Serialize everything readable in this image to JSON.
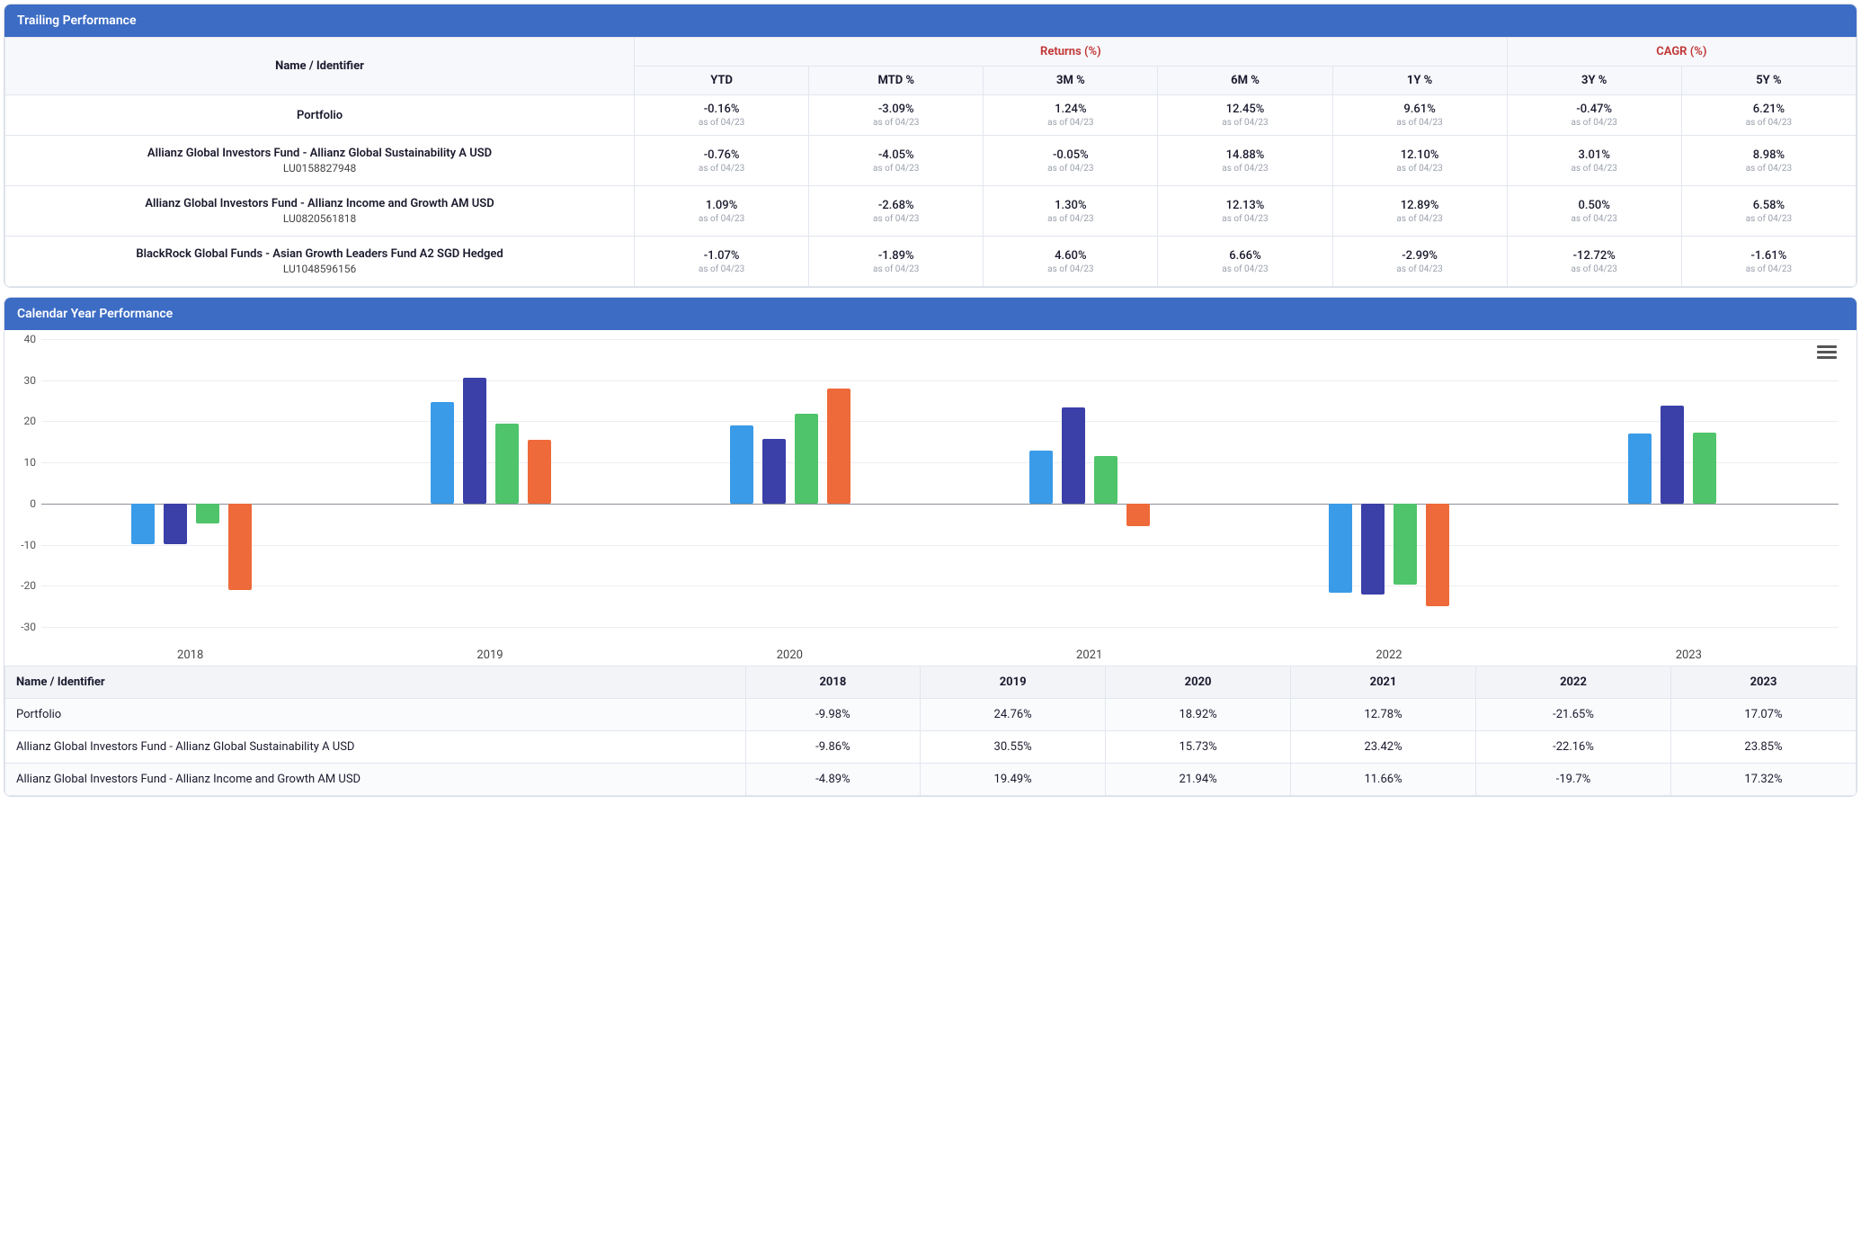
{
  "trailing": {
    "title": "Trailing Performance",
    "col_name": "Name / Identifier",
    "group_returns": "Returns (%)",
    "group_cagr": "CAGR (%)",
    "cols": [
      "YTD",
      "MTD %",
      "3M %",
      "6M %",
      "1Y %",
      "3Y %",
      "5Y %"
    ],
    "asof": "as of 04/23",
    "rows": [
      {
        "name": "Portfolio",
        "sub": "",
        "vals": [
          "-0.16%",
          "-3.09%",
          "1.24%",
          "12.45%",
          "9.61%",
          "-0.47%",
          "6.21%"
        ]
      },
      {
        "name": "Allianz Global Investors Fund - Allianz Global Sustainability A USD",
        "sub": "LU0158827948",
        "vals": [
          "-0.76%",
          "-4.05%",
          "-0.05%",
          "14.88%",
          "12.10%",
          "3.01%",
          "8.98%"
        ]
      },
      {
        "name": "Allianz Global Investors Fund - Allianz Income and Growth AM USD",
        "sub": "LU0820561818",
        "vals": [
          "1.09%",
          "-2.68%",
          "1.30%",
          "12.13%",
          "12.89%",
          "0.50%",
          "6.58%"
        ]
      },
      {
        "name": "BlackRock Global Funds - Asian Growth Leaders Fund A2 SGD Hedged",
        "sub": "LU1048596156",
        "vals": [
          "-1.07%",
          "-1.89%",
          "4.60%",
          "6.66%",
          "-2.99%",
          "-12.72%",
          "-1.61%"
        ]
      }
    ]
  },
  "calendar": {
    "title": "Calendar Year Performance",
    "col_name": "Name / Identifier",
    "years": [
      "2018",
      "2019",
      "2020",
      "2021",
      "2022",
      "2023"
    ],
    "rows": [
      {
        "name": "Portfolio",
        "vals": [
          "-9.98%",
          "24.76%",
          "18.92%",
          "12.78%",
          "-21.65%",
          "17.07%"
        ]
      },
      {
        "name": "Allianz Global Investors Fund - Allianz Global Sustainability A USD",
        "vals": [
          "-9.86%",
          "30.55%",
          "15.73%",
          "23.42%",
          "-22.16%",
          "23.85%"
        ]
      },
      {
        "name": "Allianz Global Investors Fund - Allianz Income and Growth AM USD",
        "vals": [
          "-4.89%",
          "19.49%",
          "21.94%",
          "11.66%",
          "-19.7%",
          "17.32%"
        ]
      }
    ]
  },
  "chart_data": {
    "type": "bar",
    "title": "",
    "xlabel": "",
    "ylabel": "",
    "ylim": [
      -30,
      40
    ],
    "yticks": [
      -30,
      -20,
      -10,
      0,
      10,
      20,
      30,
      40
    ],
    "categories": [
      "2018",
      "2019",
      "2020",
      "2021",
      "2022",
      "2023"
    ],
    "series": [
      {
        "name": "Portfolio",
        "color": "#3a9be8",
        "values": [
          -9.98,
          24.76,
          18.92,
          12.78,
          -21.65,
          17.07
        ]
      },
      {
        "name": "Allianz Global Sustainability A USD",
        "color": "#3b3fa8",
        "values": [
          -9.86,
          30.55,
          15.73,
          23.42,
          -22.16,
          23.85
        ]
      },
      {
        "name": "Allianz Income and Growth AM USD",
        "color": "#4fc46a",
        "values": [
          -4.89,
          19.49,
          21.94,
          11.66,
          -19.7,
          17.32
        ]
      },
      {
        "name": "BlackRock Asian Growth Leaders A2 SGD Hedged",
        "color": "#ee6a3a",
        "values": [
          -21.0,
          15.5,
          28.0,
          -5.5,
          -25.0,
          null
        ]
      }
    ]
  }
}
